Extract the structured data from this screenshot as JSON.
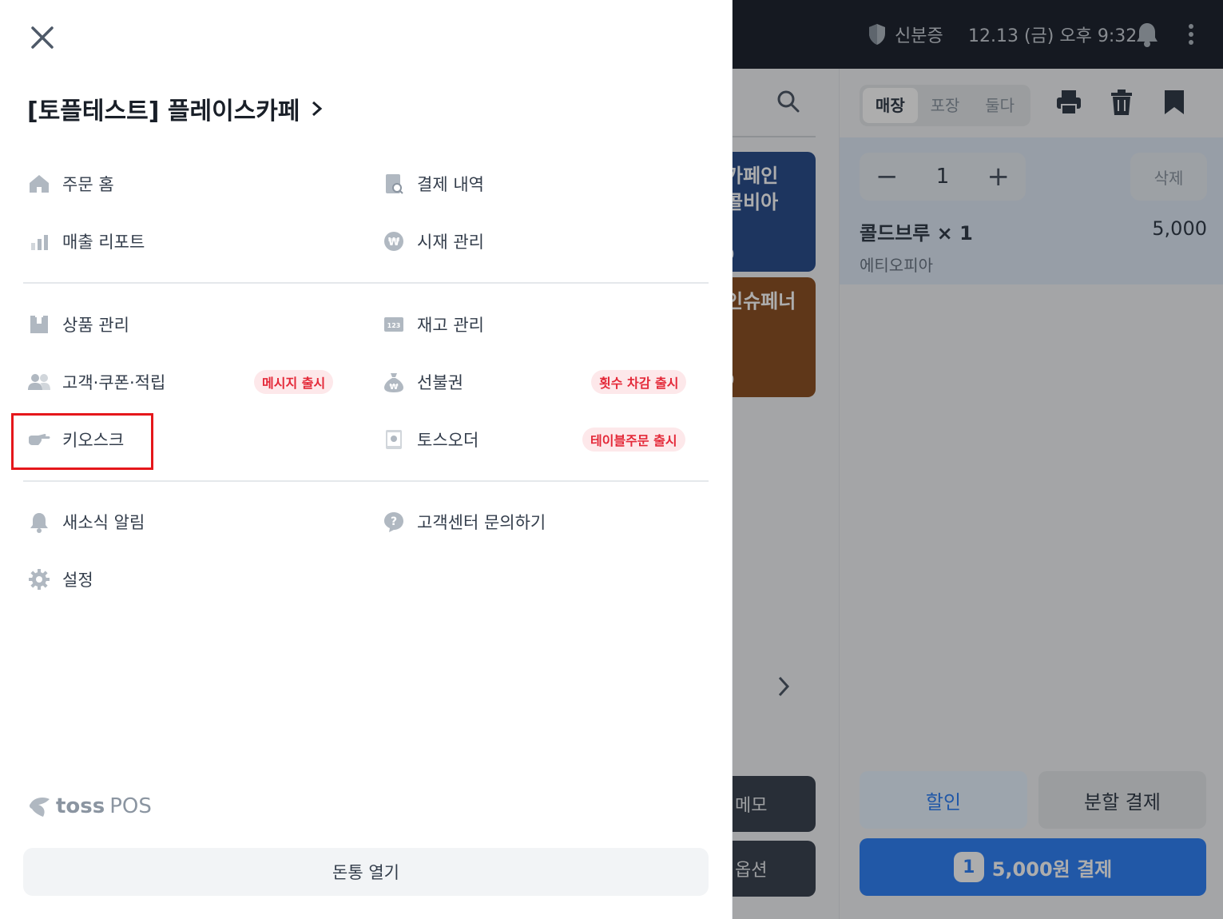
{
  "topbar": {
    "id_label": "신분증",
    "datetime": "12.13 (금) 오후 9:32"
  },
  "products": [
    {
      "name_line1": "카페인",
      "name_line2": "콜비아",
      "price": "0",
      "color": "#2c4f8c"
    },
    {
      "name_line1": "인슈페너",
      "name_line2": "",
      "price": "0",
      "color": "#8c5225"
    }
  ],
  "left_buttons": {
    "memo": "메모",
    "options": "옵션"
  },
  "order_type": {
    "options": [
      "매장",
      "포장",
      "둘다"
    ],
    "selected": "매장"
  },
  "cart": {
    "qty": "1",
    "delete_label": "삭제",
    "item_name": "콜드브루 × 1",
    "item_option": "에티오피아",
    "item_price": "5,000",
    "discount_label": "할인",
    "split_label": "분할 결제",
    "pay_count": "1",
    "pay_label": "5,000원 결제"
  },
  "drawer": {
    "store_name": "[토플테스트] 플레이스카페",
    "groups": [
      [
        {
          "label": "주문 홈",
          "icon": "home-icon"
        },
        {
          "label": "결제 내역",
          "icon": "receipt-search-icon"
        },
        {
          "label": "매출 리포트",
          "icon": "bar-chart-icon"
        },
        {
          "label": "시재 관리",
          "icon": "won-coin-icon"
        }
      ],
      [
        {
          "label": "상품 관리",
          "icon": "box-icon"
        },
        {
          "label": "재고 관리",
          "icon": "inventory-123-icon"
        },
        {
          "label": "고객·쿠폰·적립",
          "icon": "users-icon",
          "badge": "메시지 출시"
        },
        {
          "label": "선불권",
          "icon": "money-bag-icon",
          "badge": "횟수 차감 출시"
        },
        {
          "label": "키오스크",
          "icon": "pointing-hand-icon"
        },
        {
          "label": "토스오더",
          "icon": "tablet-icon",
          "badge": "테이블주문 출시"
        }
      ],
      [
        {
          "label": "새소식 알림",
          "icon": "bell-icon"
        },
        {
          "label": "고객센터 문의하기",
          "icon": "question-icon"
        },
        {
          "label": "설정",
          "icon": "gear-icon"
        }
      ]
    ],
    "logo_toss": "toss",
    "logo_pos": "POS",
    "open_drawer_label": "돈통 열기"
  },
  "colors": {
    "accent": "#3182f6",
    "badge_bg": "#fde8ea",
    "badge_text": "#e42939",
    "highlight": "#e5171b"
  }
}
